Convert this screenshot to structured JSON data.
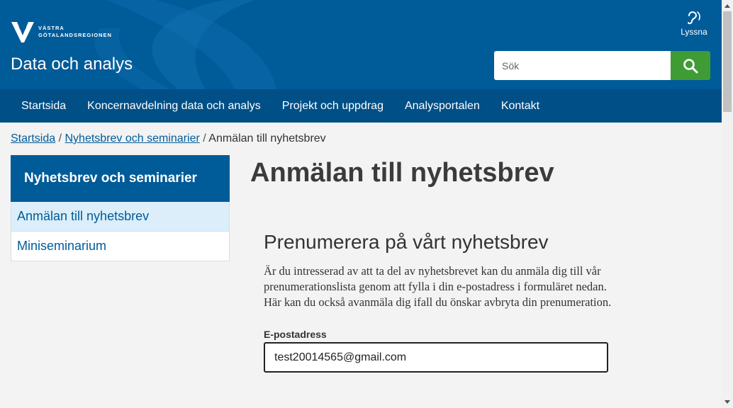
{
  "header": {
    "logo_line1": "VÄSTRA",
    "logo_line2": "GÖTALANDSREGIONEN",
    "site_title": "Data och analys",
    "listen_label": "Lyssna",
    "search_placeholder": "Sök"
  },
  "nav": {
    "items": [
      {
        "label": "Startsida"
      },
      {
        "label": "Koncernavdelning data och analys"
      },
      {
        "label": "Projekt och uppdrag"
      },
      {
        "label": "Analysportalen"
      },
      {
        "label": "Kontakt"
      }
    ]
  },
  "breadcrumb": {
    "items": [
      "Startsida",
      "Nyhetsbrev och seminarier"
    ],
    "separator": "/",
    "current": "Anmälan till nyhetsbrev"
  },
  "sidebar": {
    "title": "Nyhetsbrev och seminarier",
    "items": [
      {
        "label": "Anmälan till nyhetsbrev"
      },
      {
        "label": "Miniseminarium"
      }
    ]
  },
  "main": {
    "title": "Anmälan till nyhetsbrev",
    "subtitle": "Prenumerera på vårt nyhetsbrev",
    "intro": "Är du intresserad av att ta del av nyhetsbrevet kan du anmäla dig till vår prenumerationslista genom att fylla i din e-postadress i formuläret nedan. Här kan du också avanmäla dig ifall du önskar avbryta din prenumeration.",
    "email_label": "E-postadress",
    "email_value": "test20014565@gmail.com"
  },
  "colors": {
    "brand_blue": "#005b99",
    "nav_blue": "#004f86",
    "search_green": "#3f9c35",
    "active_item_bg": "#dbeefa"
  }
}
